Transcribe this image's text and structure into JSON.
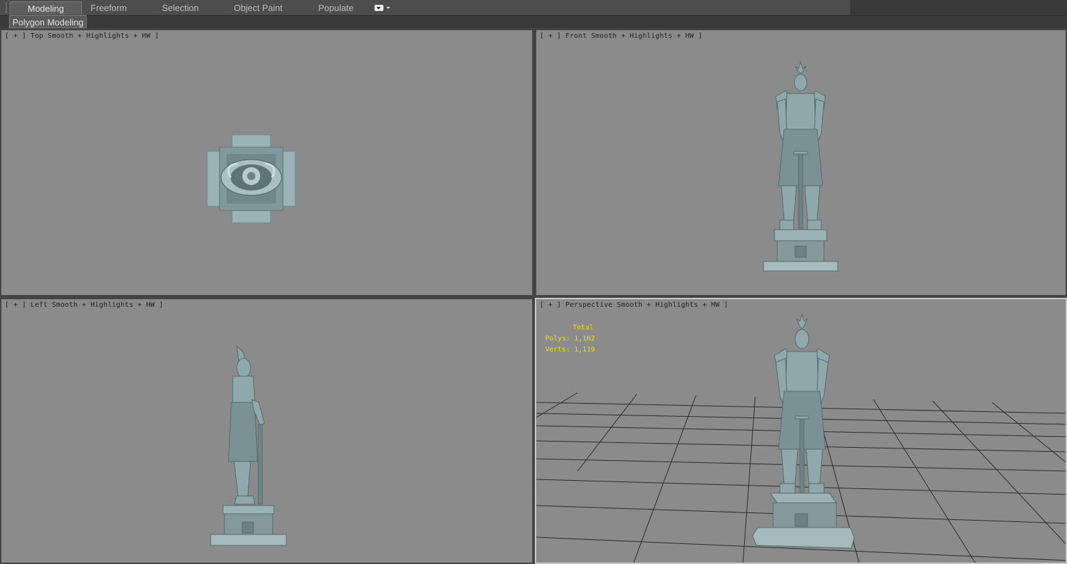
{
  "ribbon": {
    "tabs": [
      {
        "label": "Modeling",
        "active": true
      },
      {
        "label": "Freeform",
        "active": false
      },
      {
        "label": "Selection",
        "active": false
      },
      {
        "label": "Object Paint",
        "active": false
      },
      {
        "label": "Populate",
        "active": false
      }
    ],
    "panel_label": "Polygon Modeling"
  },
  "viewports": {
    "top": {
      "plus": "[ + ]",
      "view": "Top",
      "shading": "Smooth + Highlights + HW ]"
    },
    "front": {
      "plus": "[ + ]",
      "view": "Front",
      "shading": "Smooth + Highlights + HW ]"
    },
    "left": {
      "plus": "[ + ]",
      "view": "Left",
      "shading": "Smooth + Highlights + HW ]"
    },
    "persp": {
      "plus": "[ + ]",
      "view": "Perspective",
      "shading": "Smooth + Highlights + HW ]"
    }
  },
  "stats": {
    "title": "Total",
    "polys": "Polys: 1,162",
    "verts": "Verts: 1,119"
  },
  "colors": {
    "viewport_bg": "#8b8b8b",
    "stat_text": "#f2e200",
    "active_border": "#c9c9c9",
    "statue": "#8fa8ab"
  }
}
